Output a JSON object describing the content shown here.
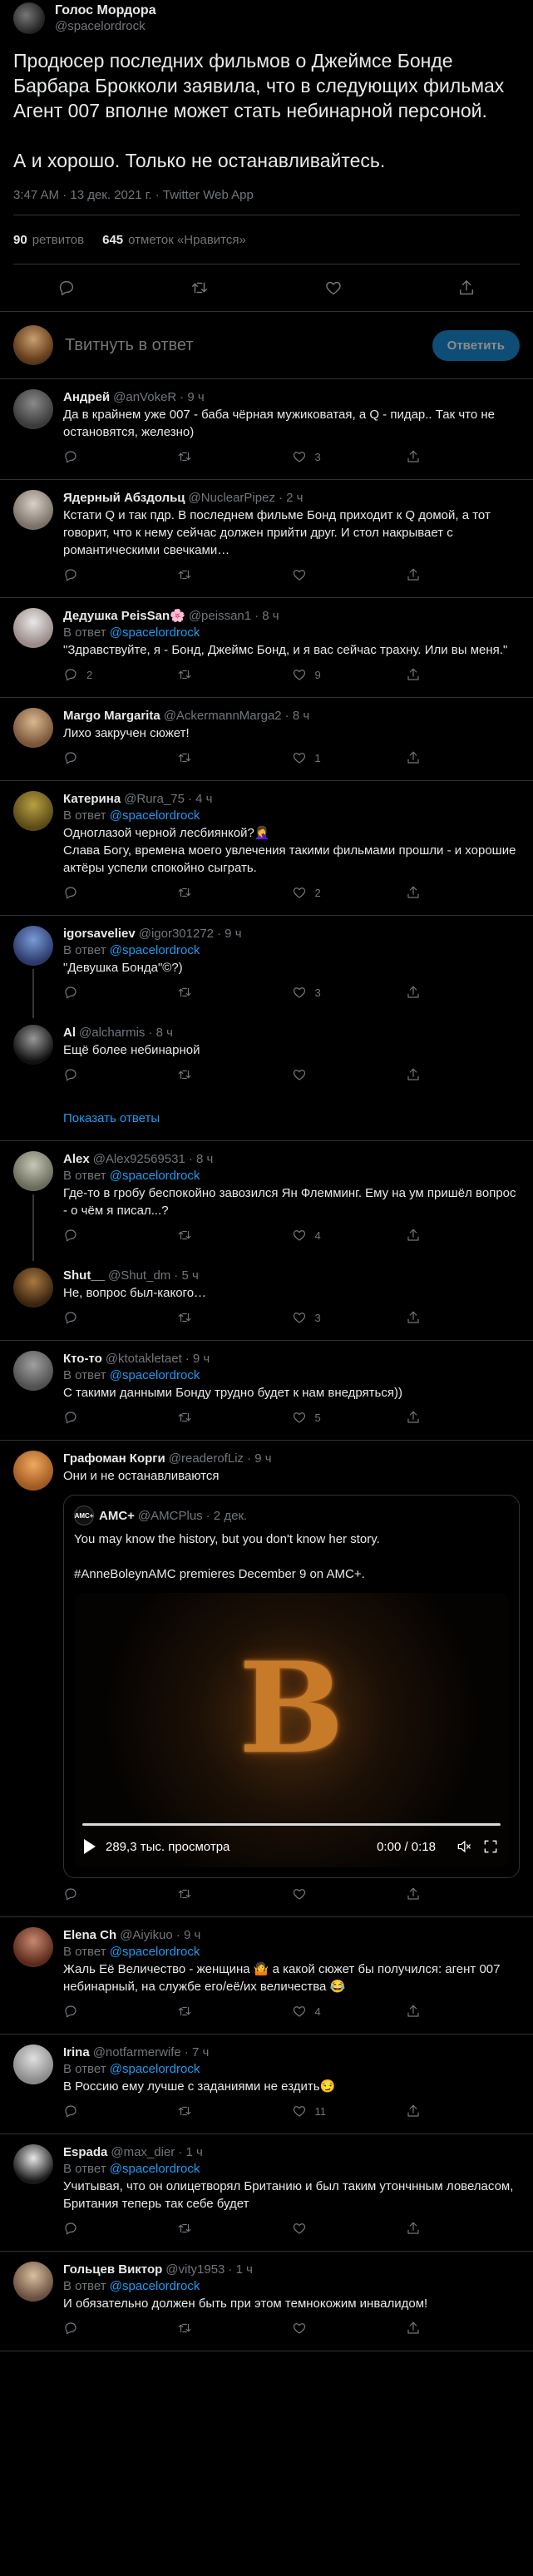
{
  "colors": {
    "background": "#000000",
    "text": "#e7e9ea",
    "muted": "#71767b",
    "link": "#1d9bf0",
    "separator": "#2f3336",
    "reply_button": "#1a8cd8"
  },
  "main_tweet": {
    "author_name": "Голос Мордора",
    "author_handle": "@spacelordrock",
    "text": "Продюсер последних фильмов о Джеймсе Бонде Барбара Брокколи заявила, что в следующих фильмах Агент 007 вполне может стать небинарной персоной.\n\nА и хорошо. Только не останавливайтесь.",
    "timestamp": "3:47 AM · 13 дек. 2021 г. · Twitter Web App",
    "retweets_count": "90",
    "retweets_label": "ретвитов",
    "likes_count": "645",
    "likes_label": "отметок «Нравится»"
  },
  "reply_compose": {
    "placeholder": "Твитнуть в ответ",
    "button_label": "Ответить"
  },
  "show_more_label": "Показать ответы",
  "in_reply_prefix": "В ответ",
  "replies": [
    {
      "name": "Андрей",
      "handle": "@anVokeR",
      "time": "· 9 ч",
      "in_reply_to": "",
      "text": "Да в крайнем уже 007 - баба чёрная мужиковатая, а Q - пидар.. Так что не остановятся, железно)",
      "counts": {
        "reply": "",
        "retweet": "",
        "like": "3"
      },
      "thread": false,
      "show_more": false
    },
    {
      "name": "Ядерный Абздольц",
      "handle": "@NuclearPipez",
      "time": "· 2 ч",
      "in_reply_to": "",
      "text": "Кстати Q и так пдр. В последнем фильме Бонд приходит к Q домой, а тот говорит, что к нему сейчас должен прийти друг. И стол накрывает с романтическими свечками…",
      "counts": {
        "reply": "",
        "retweet": "",
        "like": ""
      },
      "thread": false,
      "show_more": false
    },
    {
      "name": "Дедушка PeisSan🌸",
      "handle": "@peissan1",
      "time": "· 8 ч",
      "in_reply_to": "@spacelordrock",
      "text": "\"Здравствуйте, я - Бонд, Джеймс Бонд, и я вас сейчас трахну. Или вы меня.\"",
      "counts": {
        "reply": "2",
        "retweet": "",
        "like": "9"
      },
      "thread": false,
      "show_more": false
    },
    {
      "name": "Margo Margarita",
      "handle": "@AckermannMarga2",
      "time": "· 8 ч",
      "in_reply_to": "",
      "text": "Лихо закручен сюжет!",
      "counts": {
        "reply": "",
        "retweet": "",
        "like": "1"
      },
      "thread": false,
      "show_more": false
    },
    {
      "name": "Катерина",
      "handle": "@Rura_75",
      "time": "· 4 ч",
      "in_reply_to": "@spacelordrock",
      "text": "Одноглазой черной лесбиянкой?🤦‍♀️\nСлава Богу, времена моего увлечения такими фильмами прошли - и хорошие актёры успели спокойно сыграть.",
      "counts": {
        "reply": "",
        "retweet": "",
        "like": "2"
      },
      "thread": false,
      "show_more": false
    },
    {
      "name": "igorsaveliev",
      "handle": "@igor301272",
      "time": "· 9 ч",
      "in_reply_to": "@spacelordrock",
      "text": "\"Девушка Бонда\"©?)",
      "counts": {
        "reply": "",
        "retweet": "",
        "like": "3"
      },
      "thread": true,
      "show_more": false
    },
    {
      "name": "Al",
      "handle": "@alcharmis",
      "time": "· 8 ч",
      "in_reply_to": "",
      "text": "Ещё более небинарной",
      "counts": {
        "reply": "",
        "retweet": "",
        "like": ""
      },
      "thread": false,
      "show_more": true
    },
    {
      "name": "Alex",
      "handle": "@Alex92569531",
      "time": "· 8 ч",
      "in_reply_to": "@spacelordrock",
      "text": "Где-то в гробу беспокойно завозился Ян Флемминг. Ему на ум пришёл вопрос - о чём я писал...?",
      "counts": {
        "reply": "",
        "retweet": "",
        "like": "4"
      },
      "thread": true,
      "show_more": false
    },
    {
      "name": "Shut__",
      "handle": "@Shut_dm",
      "time": "· 5 ч",
      "in_reply_to": "",
      "text": "Не, вопрос был-какого…",
      "counts": {
        "reply": "",
        "retweet": "",
        "like": "3"
      },
      "thread": false,
      "show_more": false
    },
    {
      "name": "Кто-то",
      "handle": "@ktotakletaet",
      "time": "· 9 ч",
      "in_reply_to": "@spacelordrock",
      "text": "С такими данными Бонду трудно будет к нам внедряться))",
      "counts": {
        "reply": "",
        "retweet": "",
        "like": "5"
      },
      "thread": false,
      "show_more": false
    },
    {
      "name": "Графоман Корги",
      "handle": "@readerofLiz",
      "time": "· 9 ч",
      "in_reply_to": "",
      "text": "Они и не останавливаются",
      "counts": {
        "reply": "",
        "retweet": "",
        "like": ""
      },
      "thread": false,
      "show_more": false,
      "quote": {
        "avatar_text": "AMC+",
        "name": "AMC+",
        "handle": "@AMCPlus",
        "time": "· 2 дек.",
        "text": "You may know the history, but you don't know her story.\n\n#AnneBoleynAMC premieres December 9 on AMC+.",
        "video_letter": "B",
        "views": "289,3 тыс. просмотра",
        "duration": "0:00 / 0:18"
      }
    },
    {
      "name": "Elena Ch",
      "handle": "@Aiyikuo",
      "time": "· 9 ч",
      "in_reply_to": "@spacelordrock",
      "text": "Жаль Её Величество - женщина 🤷 а какой сюжет бы получился:  агент 007 небинарный, на службе его/её/их величества 😂",
      "counts": {
        "reply": "",
        "retweet": "",
        "like": "4"
      },
      "thread": false,
      "show_more": false
    },
    {
      "name": "Irina",
      "handle": "@notfarmerwife",
      "time": "· 7 ч",
      "in_reply_to": "@spacelordrock",
      "text": "В Россию ему лучше с заданиями не ездить😏",
      "counts": {
        "reply": "",
        "retweet": "",
        "like": "11"
      },
      "thread": false,
      "show_more": false
    },
    {
      "name": "Espada",
      "handle": "@max_dier",
      "time": "· 1 ч",
      "in_reply_to": "@spacelordrock",
      "text": "Учитывая, что он олицетворял Британию и был таким утончнным ловеласом, Британия теперь так себе будет",
      "counts": {
        "reply": "",
        "retweet": "",
        "like": ""
      },
      "thread": false,
      "show_more": false
    },
    {
      "name": "Гольцев Виктор",
      "handle": "@vity1953",
      "time": "· 1 ч",
      "in_reply_to": "@spacelordrock",
      "text": "И обязательно должен быть при этом темнокожим инвалидом!",
      "counts": {
        "reply": "",
        "retweet": "",
        "like": ""
      },
      "thread": false,
      "show_more": false
    }
  ]
}
